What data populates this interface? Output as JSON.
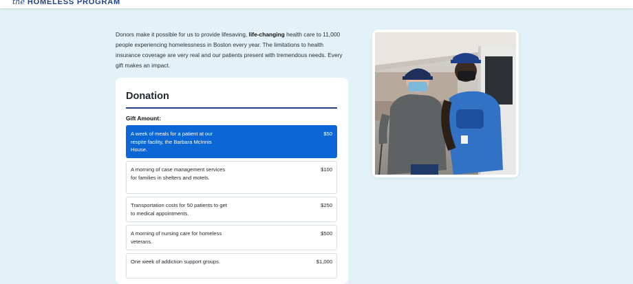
{
  "header": {
    "brand_prefix": "the",
    "brand_name": "HOMELESS PROGRAM"
  },
  "intro": {
    "text_before": "Donors make it possible for us to provide lifesaving, ",
    "text_bold": "life-changing",
    "text_after": " health care to 11,000 people experiencing homelessness in Boston every year. The limitations to health insurance coverage are very real and our patients present with tremendous needs. Every gift makes an impact."
  },
  "donation": {
    "title": "Donation",
    "gift_label": "Gift Amount:",
    "selected_index": 0,
    "options": [
      {
        "description": "A week of meals for a patient at our respite facility, the Barbara McInnis House.",
        "amount": "$50"
      },
      {
        "description": "A morning of case management services for families in shelters and motels.",
        "amount": "$100"
      },
      {
        "description": "Transportation costs for 50 patients to get to medical appointments.",
        "amount": "$250"
      },
      {
        "description": "A morning of nursing care for homeless veterans.",
        "amount": "$500"
      },
      {
        "description": "One week of addiction support groups.",
        "amount": "$1,000"
      }
    ]
  },
  "colors": {
    "page_background": "#e3f1f8",
    "brand": "#1c3f8a",
    "selected_option": "#0b66d6"
  },
  "photo": {
    "icon": "people-photo"
  }
}
